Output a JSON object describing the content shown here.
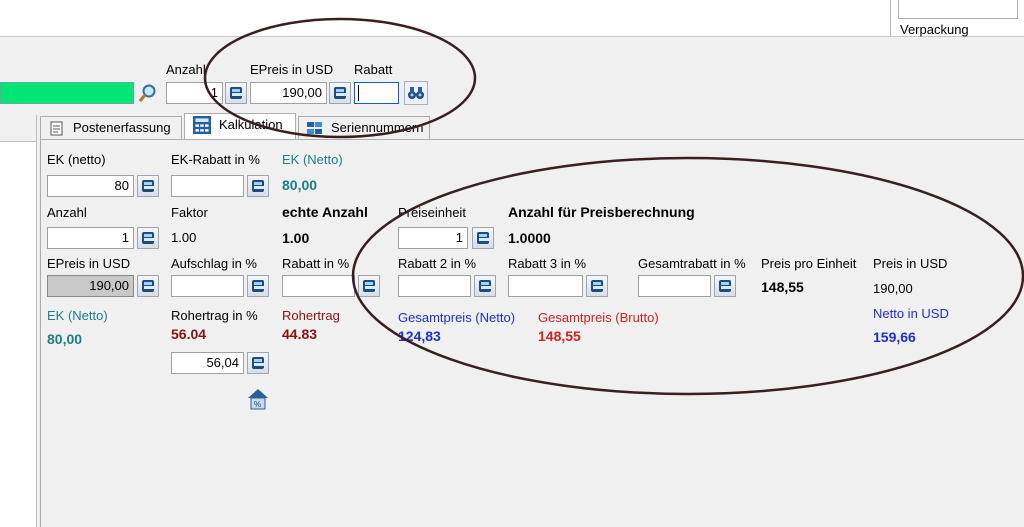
{
  "header": {
    "top_field": "Verpackung",
    "anzahl_label": "Anzahl",
    "anzahl_value": "1",
    "epreis_label": "EPreis in USD",
    "epreis_value": "190,00",
    "rabatt_label": "Rabatt",
    "rabatt_value": ""
  },
  "tabs": [
    {
      "label": "Postenerfassung",
      "selected": false
    },
    {
      "label": "Kalkulation",
      "selected": true
    },
    {
      "label": "Seriennummern",
      "selected": false
    }
  ],
  "kalkulation": {
    "ek_netto_label": "EK (netto)",
    "ek_netto_value": "80",
    "ek_rabatt_label": "EK-Rabatt in %",
    "ek_rabatt_value": "",
    "ek_netto2_label": "EK (Netto)",
    "ek_netto2_value": "80,00",
    "anzahl_label": "Anzahl",
    "anzahl_value": "1",
    "faktor_label": "Faktor",
    "faktor_value": "1.00",
    "echte_anzahl_label": "echte Anzahl",
    "echte_anzahl_value": "1.00",
    "preiseinheit_label": "Preiseinheit",
    "preiseinheit_value": "1",
    "anzahl_preis_label": "Anzahl für Preisberechnung",
    "anzahl_preis_value": "1.0000",
    "epreis_label": "EPreis in USD",
    "epreis_value": "190,00",
    "aufschlag_label": "Aufschlag in %",
    "aufschlag_value": "",
    "rabatt_label": "Rabatt in %",
    "rabatt_value": "",
    "rabatt2_label": "Rabatt 2 in %",
    "rabatt2_value": "",
    "rabatt3_label": "Rabatt 3 in %",
    "rabatt3_value": "",
    "gesamtrabatt_label": "Gesamtrabatt in %",
    "gesamtrabatt_value": "",
    "preis_pro_einheit_label": "Preis pro Einheit",
    "preis_pro_einheit_value": "148,55",
    "preis_usd_label": "Preis in USD",
    "preis_usd_value": "190,00",
    "ek_netto3_label": "EK (Netto)",
    "ek_netto3_value": "80,00",
    "rohertrag_pct_label": "Rohertrag in %",
    "rohertrag_pct_value": "56.04",
    "rohertrag_label": "Rohertrag",
    "rohertrag_value": "44.83",
    "gesamtpreis_netto_label": "Gesamtpreis (Netto)",
    "gesamtpreis_netto_value": "124,83",
    "gesamtpreis_brutto_label": "Gesamtpreis (Brutto)",
    "gesamtpreis_brutto_value": "148,55",
    "netto_usd_label": "Netto in USD",
    "netto_usd_value": "159,66",
    "rohertrag_input_value": "56,04"
  },
  "colors": {
    "green_field": "#00e676",
    "teal": "#1b7f86",
    "red": "#d42020",
    "blue": "#1d2ed6",
    "annotation": "#3a1f1f"
  }
}
